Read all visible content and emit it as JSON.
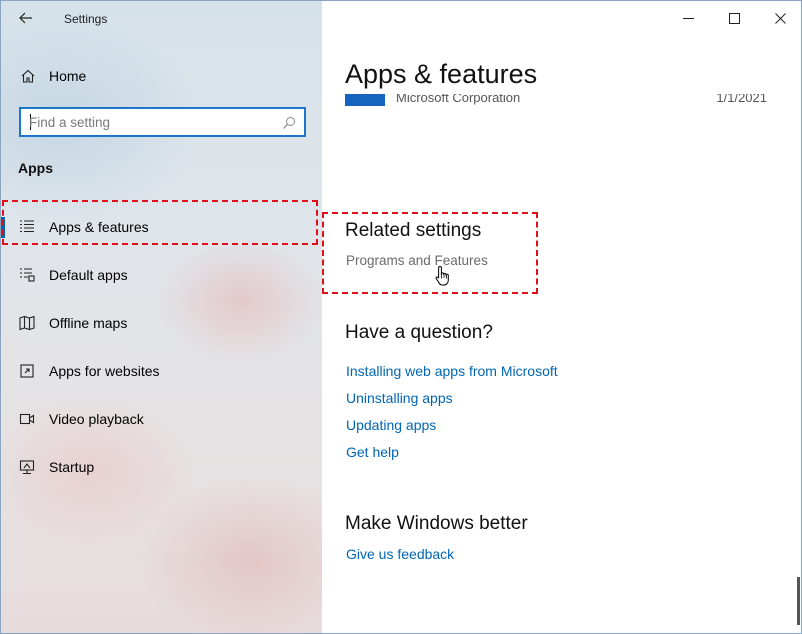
{
  "window": {
    "title": "Settings",
    "controls": [
      "minimize-icon",
      "maximize-icon",
      "close-icon"
    ]
  },
  "sidebar": {
    "home_label": "Home",
    "search": {
      "placeholder": "Find a setting"
    },
    "section_heading": "Apps",
    "items": [
      {
        "label": "Apps & features",
        "icon": "apps-features-icon",
        "selected": true
      },
      {
        "label": "Default apps",
        "icon": "default-apps-icon",
        "selected": false
      },
      {
        "label": "Offline maps",
        "icon": "offline-maps-icon",
        "selected": false
      },
      {
        "label": "Apps for websites",
        "icon": "apps-for-websites-icon",
        "selected": false
      },
      {
        "label": "Video playback",
        "icon": "video-playback-icon",
        "selected": false
      },
      {
        "label": "Startup",
        "icon": "startup-icon",
        "selected": false
      }
    ]
  },
  "main": {
    "page_title": "Apps & features",
    "clipped_app": {
      "publisher": "Microsoft Corporation",
      "date": "1/1/2021"
    },
    "related": {
      "heading": "Related settings",
      "link": "Programs and Features"
    },
    "question": {
      "heading": "Have a question?",
      "links": [
        "Installing web apps from Microsoft",
        "Uninstalling apps",
        "Updating apps",
        "Get help"
      ]
    },
    "better": {
      "heading": "Make Windows better",
      "link": "Give us feedback"
    }
  },
  "colors": {
    "accent": "#0063b1",
    "link": "#0066b4",
    "annotation": "#e0101a"
  }
}
